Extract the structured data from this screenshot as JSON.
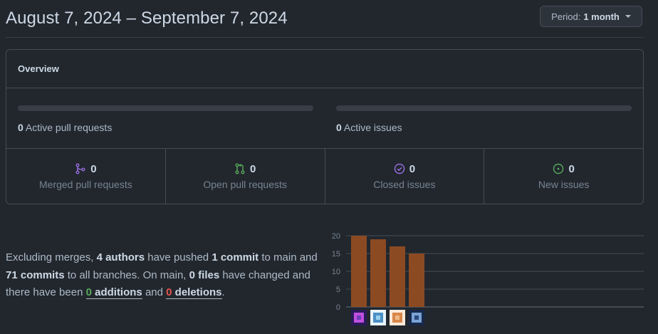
{
  "header": {
    "title": "August 7, 2024 – September 7, 2024",
    "period_prefix": "Period:",
    "period_value": "1 month"
  },
  "overview": {
    "heading": "Overview",
    "active_pull_requests": {
      "count": "0",
      "label": "Active pull requests",
      "fraction": 0
    },
    "active_issues": {
      "count": "0",
      "label": "Active issues",
      "fraction": 0
    },
    "stats": [
      {
        "count": "0",
        "label": "Merged pull requests",
        "icon": "merge-icon",
        "color": "#986ee2"
      },
      {
        "count": "0",
        "label": "Open pull requests",
        "icon": "pull-request-icon",
        "color": "#57ab5a"
      },
      {
        "count": "0",
        "label": "Closed issues",
        "icon": "issue-closed-icon",
        "color": "#986ee2"
      },
      {
        "count": "0",
        "label": "New issues",
        "icon": "issue-opened-icon",
        "color": "#57ab5a"
      }
    ]
  },
  "summary": {
    "t1": "Excluding merges, ",
    "authors": "4 authors",
    "t2": " have pushed ",
    "commits_main": "1 commit",
    "t3": " to main and ",
    "commits_all": "71 commits",
    "t4": " to all branches. On main, ",
    "files": "0 files",
    "t5": " have changed and there have been ",
    "additions_count": "0",
    "additions_word": " additions",
    "t6": " and ",
    "deletions_count": "0",
    "deletions_word": " deletions",
    "t7": "."
  },
  "colors": {
    "bar": "#8c4a22",
    "green": "#57ab5a",
    "red": "#e5534b",
    "purple": "#986ee2"
  },
  "chart_data": {
    "type": "bar",
    "categories": [
      "author-1",
      "author-2",
      "author-3",
      "author-4"
    ],
    "values": [
      20,
      19,
      17,
      15
    ],
    "yticks": [
      0,
      5,
      10,
      15,
      20
    ],
    "ylim": [
      0,
      20
    ],
    "title": "",
    "xlabel": "",
    "ylabel": ""
  }
}
